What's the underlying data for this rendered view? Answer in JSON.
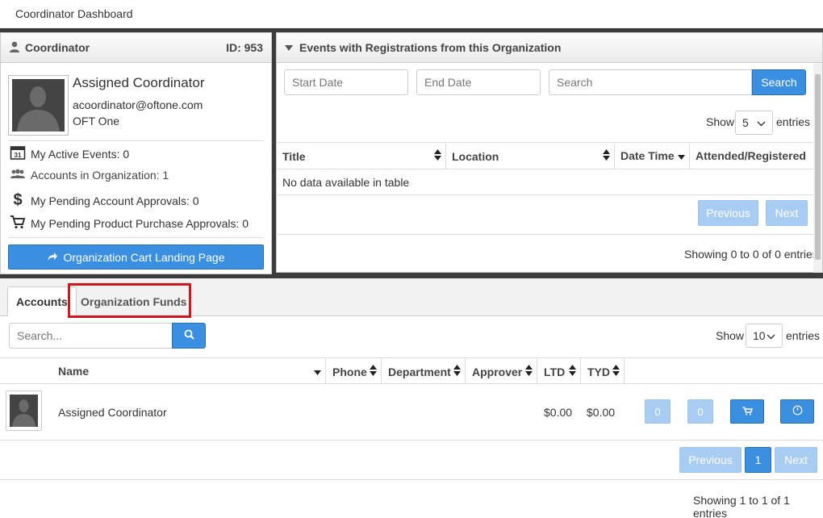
{
  "app_title": "Coordinator Dashboard",
  "coordinator_panel": {
    "title": "Coordinator",
    "id_label": "ID: 953",
    "name": "Assigned Coordinator",
    "email": "acoordinator@oftone.com",
    "org": "OFT One",
    "stats": [
      {
        "label": "My Active Events: 0",
        "icon": "calendar-icon"
      },
      {
        "label": "Accounts in Organization: 1",
        "icon": "users-icon"
      },
      {
        "label": "My Pending Account Approvals: 0",
        "icon": "dollar-icon"
      },
      {
        "label": "My Pending Product Purchase Approvals: 0",
        "icon": "cart-icon"
      }
    ],
    "cart_button": "Organization Cart Landing Page"
  },
  "events_panel": {
    "title": "Events with Registrations from this Organization",
    "start_placeholder": "Start Date",
    "end_placeholder": "End Date",
    "search_placeholder": "Search",
    "search_button": "Search",
    "show_label": "Show",
    "entries_value": "5",
    "entries_label": "entries",
    "columns": [
      "Title",
      "Location",
      "Date Time",
      "Attended/Registered"
    ],
    "empty_text": "No data available in table",
    "previous": "Previous",
    "next": "Next",
    "info": "Showing 0 to 0 of 0 entries"
  },
  "tabs": [
    {
      "label": "Accounts",
      "active": true
    },
    {
      "label": "Organization Funds",
      "active": false
    }
  ],
  "accounts": {
    "search_placeholder": "Search...",
    "show_label": "Show",
    "entries_value": "10",
    "entries_label": "entries",
    "columns": [
      "Name",
      "Phone",
      "Department",
      "Approver",
      "LTD",
      "TYD"
    ],
    "rows": [
      {
        "name": "Assigned Coordinator",
        "ltd": "$0.00",
        "tyd": "$0.00",
        "count_a": "0",
        "count_b": "0"
      }
    ],
    "previous": "Previous",
    "page": "1",
    "next": "Next",
    "info": "Showing 1 to 1 of 1 entries"
  },
  "colors": {
    "primary": "#3a8fe0",
    "primary_light": "#a9cdf2",
    "highlight": "#d0151b"
  }
}
